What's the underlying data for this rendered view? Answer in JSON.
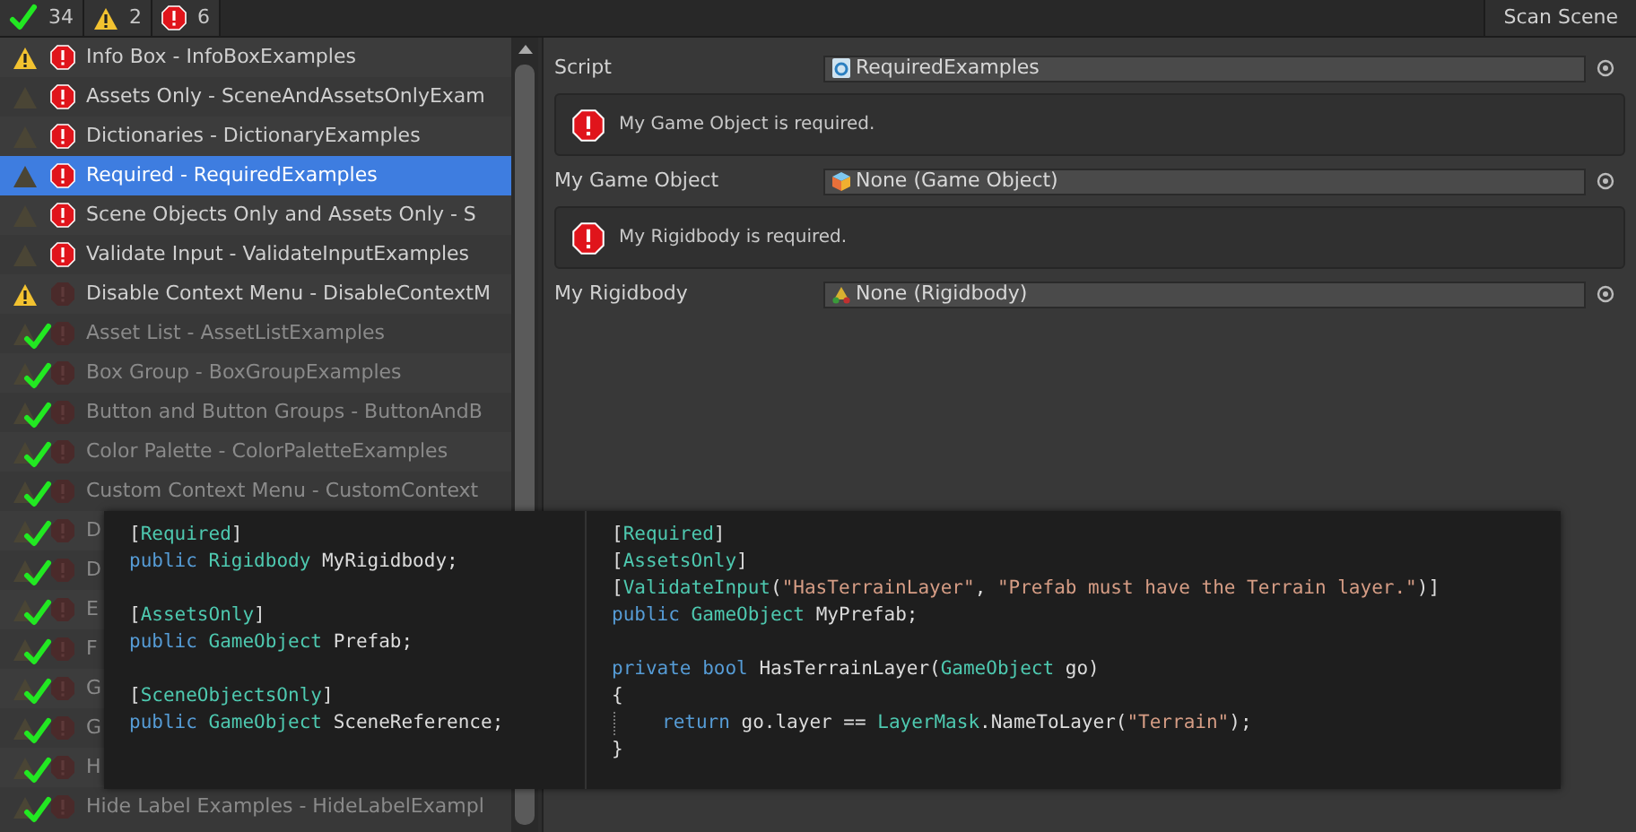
{
  "toolbar": {
    "counts": [
      {
        "kind": "passed",
        "value": "34"
      },
      {
        "kind": "warning",
        "value": "2"
      },
      {
        "kind": "error",
        "value": "6"
      }
    ],
    "scan_button": "Scan Scene"
  },
  "sidebar": {
    "items": [
      {
        "label": "Info Box - InfoBoxExamples",
        "warning": true,
        "error": true,
        "passed": false,
        "selected": false
      },
      {
        "label": "Assets Only - SceneAndAssetsOnlyExam",
        "warning": false,
        "error": true,
        "passed": false,
        "selected": false
      },
      {
        "label": "Dictionaries - DictionaryExamples",
        "warning": false,
        "error": true,
        "passed": false,
        "selected": false
      },
      {
        "label": "Required - RequiredExamples",
        "warning": false,
        "error": true,
        "passed": false,
        "selected": true
      },
      {
        "label": "Scene Objects Only and Assets Only - S",
        "warning": false,
        "error": true,
        "passed": false,
        "selected": false
      },
      {
        "label": "Validate Input - ValidateInputExamples",
        "warning": false,
        "error": true,
        "passed": false,
        "selected": false
      },
      {
        "label": "Disable Context Menu - DisableContextM",
        "warning": true,
        "error": false,
        "passed": false,
        "selected": false
      },
      {
        "label": "Asset List - AssetListExamples",
        "warning": false,
        "error": false,
        "passed": true,
        "selected": false
      },
      {
        "label": "Box Group - BoxGroupExamples",
        "warning": false,
        "error": false,
        "passed": true,
        "selected": false
      },
      {
        "label": "Button and Button Groups - ButtonAndB",
        "warning": false,
        "error": false,
        "passed": true,
        "selected": false
      },
      {
        "label": "Color Palette - ColorPaletteExamples",
        "warning": false,
        "error": false,
        "passed": true,
        "selected": false
      },
      {
        "label": "Custom Context Menu - CustomContext",
        "warning": false,
        "error": false,
        "passed": true,
        "selected": false
      },
      {
        "label": "D",
        "warning": false,
        "error": false,
        "passed": true,
        "selected": false
      },
      {
        "label": "D",
        "warning": false,
        "error": false,
        "passed": true,
        "selected": false
      },
      {
        "label": "E",
        "warning": false,
        "error": false,
        "passed": true,
        "selected": false
      },
      {
        "label": "F",
        "warning": false,
        "error": false,
        "passed": true,
        "selected": false
      },
      {
        "label": "G",
        "warning": false,
        "error": false,
        "passed": true,
        "selected": false
      },
      {
        "label": "G",
        "warning": false,
        "error": false,
        "passed": true,
        "selected": false
      },
      {
        "label": "H",
        "warning": false,
        "error": false,
        "passed": true,
        "selected": false
      },
      {
        "label": "Hide Label Examples - HideLabelExampl",
        "warning": false,
        "error": false,
        "passed": true,
        "selected": false
      }
    ]
  },
  "inspector": {
    "rows": [
      {
        "kind": "field",
        "label": "Script",
        "value": "RequiredExamples"
      },
      {
        "kind": "error",
        "message": "My Game Object is required."
      },
      {
        "kind": "field",
        "label": "My Game Object",
        "value": "None (Game Object)"
      },
      {
        "kind": "error",
        "message": "My Rigidbody is required."
      },
      {
        "kind": "field",
        "label": "My Rigidbody",
        "value": "None (Rigidbody)"
      }
    ]
  },
  "code_tooltip": {
    "panels": [
      {
        "blocks": [
          [
            {
              "tokens": [
                {
                  "text": "[",
                  "kind": "plain"
                },
                {
                  "text": "Required",
                  "kind": "type"
                },
                {
                  "text": "]",
                  "kind": "plain"
                }
              ]
            },
            {
              "tokens": [
                {
                  "text": "public ",
                  "kind": "keyword"
                },
                {
                  "text": "Rigidbody ",
                  "kind": "type"
                },
                {
                  "text": "MyRigidbody;",
                  "kind": "plain"
                }
              ]
            }
          ],
          [
            {
              "tokens": [
                {
                  "text": "[",
                  "kind": "plain"
                },
                {
                  "text": "AssetsOnly",
                  "kind": "type"
                },
                {
                  "text": "]",
                  "kind": "plain"
                }
              ]
            },
            {
              "tokens": [
                {
                  "text": "public ",
                  "kind": "keyword"
                },
                {
                  "text": "GameObject ",
                  "kind": "type"
                },
                {
                  "text": "Prefab;",
                  "kind": "plain"
                }
              ]
            }
          ],
          [
            {
              "tokens": [
                {
                  "text": "[",
                  "kind": "plain"
                },
                {
                  "text": "SceneObjectsOnly",
                  "kind": "type"
                },
                {
                  "text": "]",
                  "kind": "plain"
                }
              ]
            },
            {
              "tokens": [
                {
                  "text": "public ",
                  "kind": "keyword"
                },
                {
                  "text": "GameObject ",
                  "kind": "type"
                },
                {
                  "text": "SceneReference;",
                  "kind": "plain"
                }
              ]
            }
          ]
        ]
      },
      {
        "blocks": [
          [
            {
              "tokens": [
                {
                  "text": "[",
                  "kind": "plain"
                },
                {
                  "text": "Required",
                  "kind": "type"
                },
                {
                  "text": "]",
                  "kind": "plain"
                }
              ]
            },
            {
              "tokens": [
                {
                  "text": "[",
                  "kind": "plain"
                },
                {
                  "text": "AssetsOnly",
                  "kind": "type"
                },
                {
                  "text": "]",
                  "kind": "plain"
                }
              ]
            },
            {
              "tokens": [
                {
                  "text": "[",
                  "kind": "plain"
                },
                {
                  "text": "ValidateInput",
                  "kind": "type"
                },
                {
                  "text": "(",
                  "kind": "plain"
                },
                {
                  "text": "\"HasTerrainLayer\"",
                  "kind": "string"
                },
                {
                  "text": ", ",
                  "kind": "plain"
                },
                {
                  "text": "\"Prefab must have the Terrain layer.\"",
                  "kind": "string"
                },
                {
                  "text": ")]",
                  "kind": "plain"
                }
              ]
            },
            {
              "tokens": [
                {
                  "text": "public ",
                  "kind": "keyword"
                },
                {
                  "text": "GameObject ",
                  "kind": "type"
                },
                {
                  "text": "MyPrefab;",
                  "kind": "plain"
                }
              ]
            }
          ],
          [
            {
              "tokens": [
                {
                  "text": "private bool ",
                  "kind": "keyword"
                },
                {
                  "text": "HasTerrainLayer(",
                  "kind": "plain"
                },
                {
                  "text": "GameObject ",
                  "kind": "type"
                },
                {
                  "text": "go)",
                  "kind": "plain"
                }
              ]
            },
            {
              "tokens": [
                {
                  "text": "{",
                  "kind": "plain"
                }
              ]
            },
            {
              "indent": true,
              "tokens": [
                {
                  "text": "return ",
                  "kind": "keyword"
                },
                {
                  "text": "go.layer == ",
                  "kind": "plain"
                },
                {
                  "text": "LayerMask",
                  "kind": "type"
                },
                {
                  "text": ".NameToLayer(",
                  "kind": "plain"
                },
                {
                  "text": "\"Terrain\"",
                  "kind": "string"
                },
                {
                  "text": ");",
                  "kind": "plain"
                }
              ]
            },
            {
              "tokens": [
                {
                  "text": "}",
                  "kind": "plain"
                }
              ]
            }
          ]
        ]
      }
    ]
  }
}
